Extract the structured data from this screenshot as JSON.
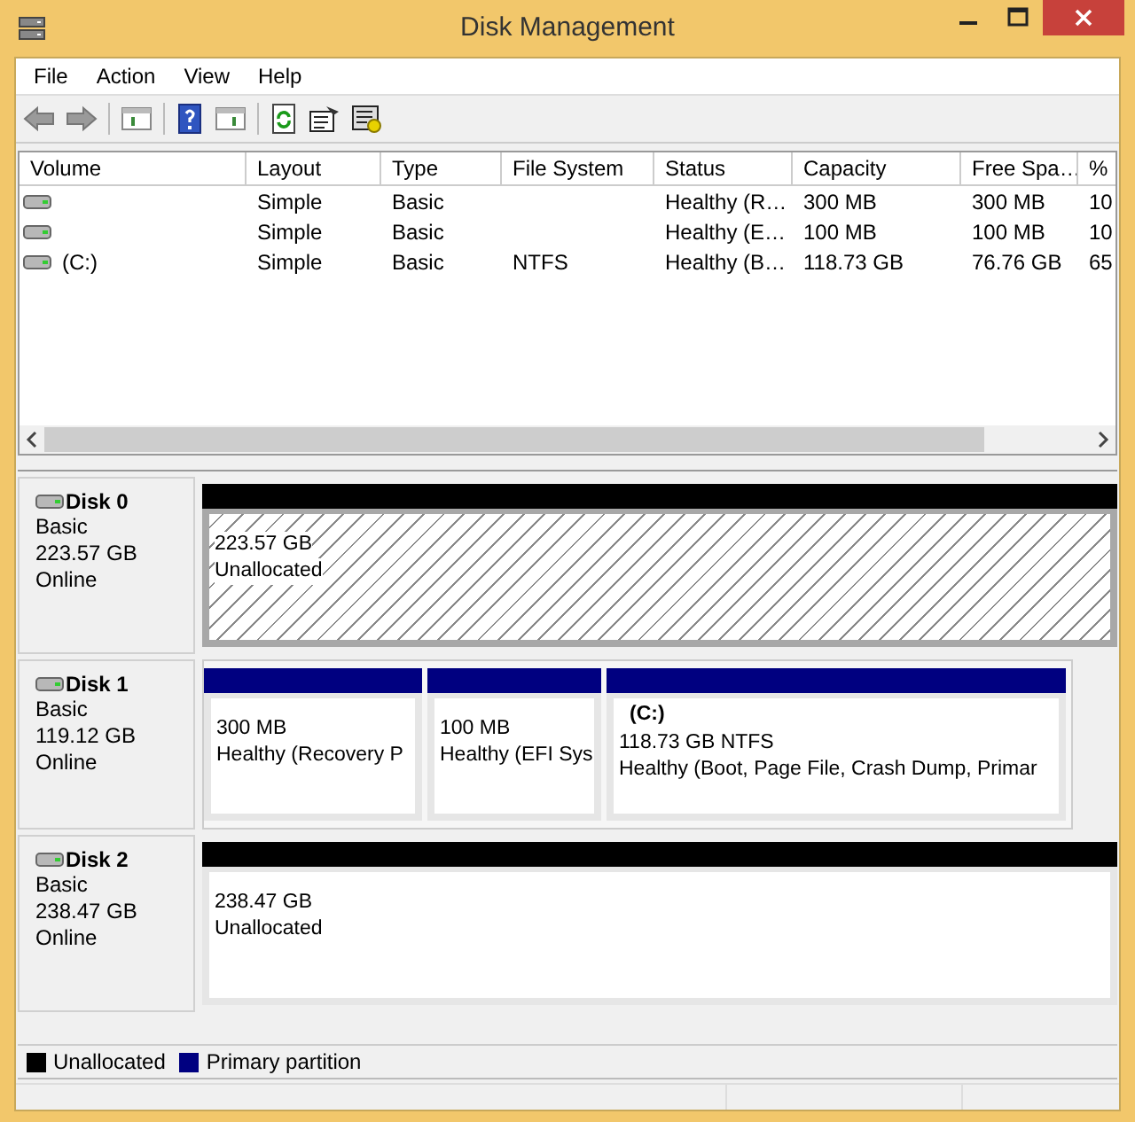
{
  "window": {
    "title": "Disk Management"
  },
  "menu": [
    "File",
    "Action",
    "View",
    "Help"
  ],
  "table": {
    "columns": [
      "Volume",
      "Layout",
      "Type",
      "File System",
      "Status",
      "Capacity",
      "Free Spa…",
      "%"
    ],
    "rows": [
      {
        "cells": [
          "",
          "Simple",
          "Basic",
          "",
          "Healthy (R…",
          "300 MB",
          "300 MB",
          "10"
        ]
      },
      {
        "cells": [
          "",
          "Simple",
          "Basic",
          "",
          "Healthy (E…",
          "100 MB",
          "100 MB",
          "10"
        ]
      },
      {
        "cells": [
          "(C:)",
          "Simple",
          "Basic",
          "NTFS",
          "Healthy (B…",
          "118.73 GB",
          "76.76 GB",
          "65"
        ]
      }
    ]
  },
  "disks": [
    {
      "name": "Disk 0",
      "type": "Basic",
      "size": "223.57 GB",
      "status": "Online",
      "partitions": [
        {
          "size": "223.57 GB",
          "status": "Unallocated",
          "color": "#000000",
          "selected": true
        }
      ]
    },
    {
      "name": "Disk 1",
      "type": "Basic",
      "size": "119.12 GB",
      "status": "Online",
      "partitions": [
        {
          "size": "300 MB",
          "status": "Healthy (Recovery P",
          "color": "#000080",
          "selected": false
        },
        {
          "size": "100 MB",
          "status": "Healthy (EFI Sys",
          "color": "#000080",
          "selected": false
        },
        {
          "label": "(C:)",
          "size": "118.73 GB NTFS",
          "status": "Healthy (Boot, Page File, Crash Dump, Primar",
          "color": "#000080",
          "selected": false
        }
      ]
    },
    {
      "name": "Disk 2",
      "type": "Basic",
      "size": "238.47 GB",
      "status": "Online",
      "partitions": [
        {
          "size": "238.47 GB",
          "status": "Unallocated",
          "color": "#000000",
          "selected": false
        }
      ]
    }
  ],
  "legend": [
    {
      "label": "Unallocated",
      "color": "#000000"
    },
    {
      "label": "Primary partition",
      "color": "#000080"
    }
  ]
}
